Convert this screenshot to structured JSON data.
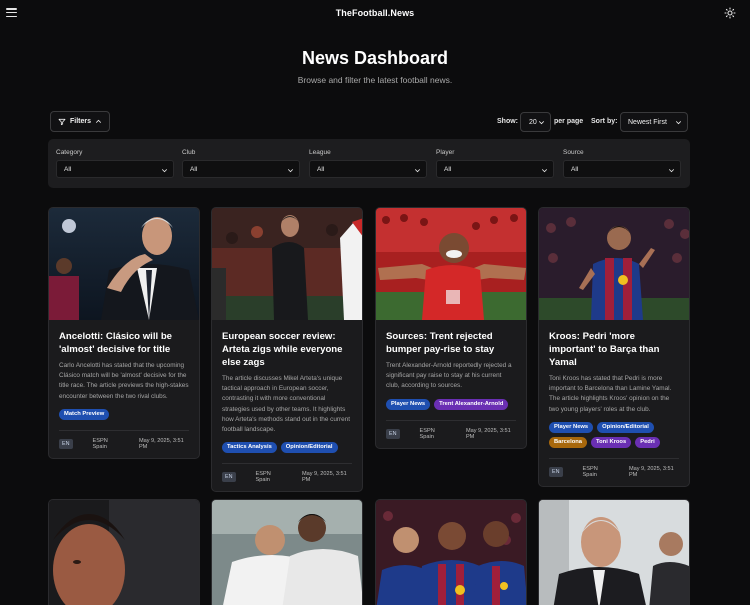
{
  "header": {
    "brand": "TheFootball.News",
    "menu_icon": "hamburger-menu-icon",
    "theme_icon": "sun-icon"
  },
  "hero": {
    "title": "News Dashboard",
    "subtitle": "Browse and filter the latest football news."
  },
  "toolbar": {
    "filters_label": "Filters",
    "show_label": "Show:",
    "show_value": "20",
    "per_page_label": "per page",
    "sort_label": "Sort by:",
    "sort_value": "Newest First"
  },
  "filters": [
    {
      "label": "Category",
      "value": "All"
    },
    {
      "label": "Club",
      "value": "All"
    },
    {
      "label": "League",
      "value": "All"
    },
    {
      "label": "Player",
      "value": "All"
    },
    {
      "label": "Source",
      "value": "All"
    }
  ],
  "articles": [
    {
      "title": "Ancelotti: Clásico will be 'almost' decisive for title",
      "description": "Carlo Ancelotti has stated that the upcoming Clásico match will be 'almost' decisive for the title race. The article previews the high-stakes encounter between the two rival clubs.",
      "tags": [
        "Match Preview"
      ],
      "lang": "EN",
      "source": "ESPN Spain",
      "date": "May 9, 2025, 3:51 PM"
    },
    {
      "title": "European soccer review: Arteta zigs while everyone else zags",
      "description": "The article discusses Mikel Arteta's unique tactical approach in European soccer, contrasting it with more conventional strategies used by other teams. It highlights how Arteta's methods stand out in the current football landscape.",
      "tags": [
        "Tactics Analysis",
        "Opinion/Editorial"
      ],
      "lang": "EN",
      "source": "ESPN Spain",
      "date": "May 9, 2025, 3:51 PM"
    },
    {
      "title": "Sources: Trent rejected bumper pay-rise to stay",
      "description": "Trent Alexander-Arnold reportedly rejected a significant pay raise to stay at his current club, according to sources.",
      "tags": [
        "Player News",
        "Trent Alexander-Arnold"
      ],
      "lang": "EN",
      "source": "ESPN Spain",
      "date": "May 9, 2025, 3:51 PM"
    },
    {
      "title": "Kroos: Pedri 'more important' to Barça than Yamal",
      "description": "Toni Kroos has stated that Pedri is more important to Barcelona than Lamine Yamal. The article highlights Kroos' opinion on the two young players' roles at the club.",
      "tags": [
        "Player News",
        "Opinion/Editorial",
        "Barcelona",
        "Toni Kroos",
        "Pedri"
      ],
      "lang": "EN",
      "source": "ESPN Spain",
      "date": "May 9, 2025, 3:51 PM"
    }
  ],
  "colors": {
    "background": "#0c0c0d",
    "card": "#1b1b1d",
    "tag_blue": "#1f4fb0",
    "tag_purple": "#6a2fb3",
    "tag_orange": "#a8680c"
  }
}
